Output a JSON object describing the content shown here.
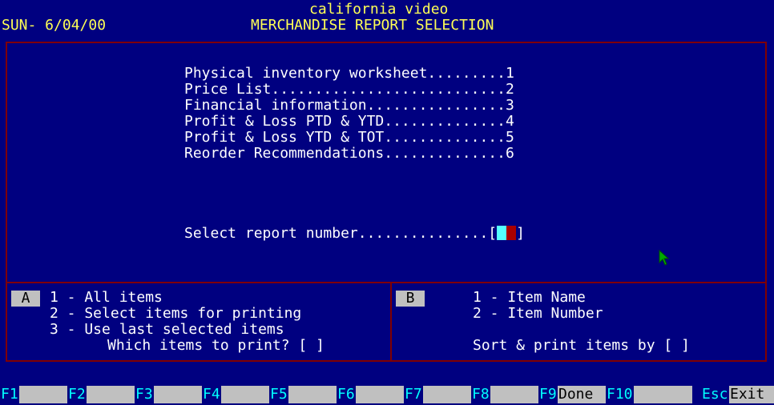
{
  "header": {
    "company": "california video",
    "date": "SUN- 6/04/00",
    "title": "MERCHANDISE REPORT SELECTION"
  },
  "menu": {
    "items": [
      "Physical inventory worksheet.........1",
      "Price List...........................2",
      "Financial information................3",
      "Profit & Loss PTD & YTD..............4",
      "Profit & Loss YTD & TOT..............5",
      "Reorder Recommendations..............6"
    ],
    "prompt": "Select report number...............[",
    "prompt_close": "]"
  },
  "panel_a": {
    "label": "A",
    "options": [
      "1 - All items",
      "2 - Select items for printing",
      "3 - Use last selected items"
    ],
    "question": "Which items to print? [ ]"
  },
  "panel_b": {
    "label": "B",
    "options": [
      "1 - Item Name",
      "2 - Item Number"
    ],
    "question": "Sort & print items by [ ]"
  },
  "fkeys": [
    {
      "key": "F1",
      "label": ""
    },
    {
      "key": "F2",
      "label": ""
    },
    {
      "key": "F3",
      "label": ""
    },
    {
      "key": "F4",
      "label": ""
    },
    {
      "key": "F5",
      "label": ""
    },
    {
      "key": "F6",
      "label": ""
    },
    {
      "key": "F7",
      "label": ""
    },
    {
      "key": "F8",
      "label": ""
    },
    {
      "key": "F9",
      "label": "Done"
    },
    {
      "key": "F10",
      "label": ""
    },
    {
      "key": "Esc",
      "label": "Exit"
    }
  ],
  "colors": {
    "background": "#000080",
    "text": "#ffffff",
    "title": "#ffff55",
    "border": "#800000",
    "fkey_key": "#00ffff",
    "fkey_bar": "#c0c0c0"
  }
}
